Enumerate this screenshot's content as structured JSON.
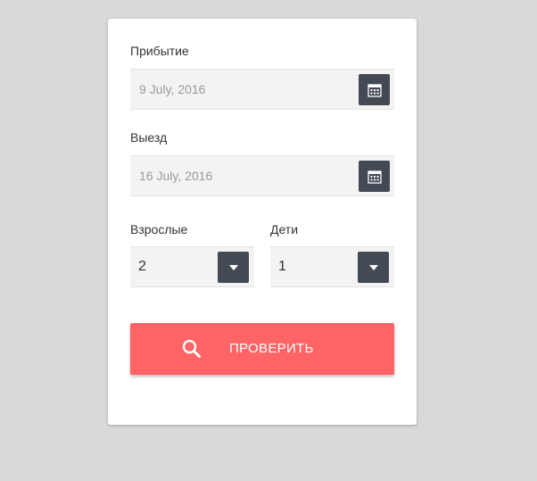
{
  "form": {
    "arrival": {
      "label": "Прибытие",
      "value": "9 July, 2016",
      "icon": "calendar-icon"
    },
    "departure": {
      "label": "Выезд",
      "value": "16 July, 2016",
      "icon": "calendar-icon"
    },
    "adults": {
      "label": "Взрослые",
      "value": "2",
      "icon": "caret-down-icon"
    },
    "children": {
      "label": "Дети",
      "value": "1",
      "icon": "caret-down-icon"
    },
    "submit": {
      "label": "ПРОВЕРИТЬ",
      "icon": "search-icon"
    }
  },
  "colors": {
    "page_bg": "#d9d9d9",
    "card_bg": "#ffffff",
    "field_bg": "#f3f3f3",
    "icon_button_bg": "#434a54",
    "accent": "#ff6466"
  }
}
